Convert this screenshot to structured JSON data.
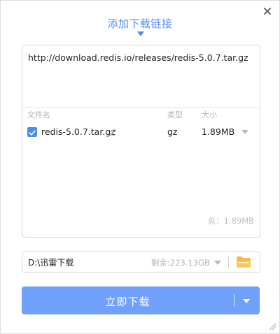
{
  "dialog": {
    "title": "添加下载链接",
    "close_icon": "close-icon"
  },
  "link": {
    "url": "http://download.redis.io/releases/redis-5.0.7.tar.gz"
  },
  "file_table": {
    "headers": {
      "name": "文件名",
      "type": "类型",
      "size": "大小"
    },
    "rows": [
      {
        "checked": true,
        "name": "redis-5.0.7.tar.gz",
        "type": "gz",
        "size": "1.89MB"
      }
    ],
    "total": "总：1.89MB"
  },
  "save_path": {
    "path": "D:\\迅雷下载",
    "free_space": "剩余:223.13GB",
    "folder_icon": "folder-icon"
  },
  "download_button": {
    "label": "立即下载"
  },
  "colors": {
    "accent": "#4d8cf5",
    "button": "#6fa0fb",
    "folder": "#f6b942"
  }
}
